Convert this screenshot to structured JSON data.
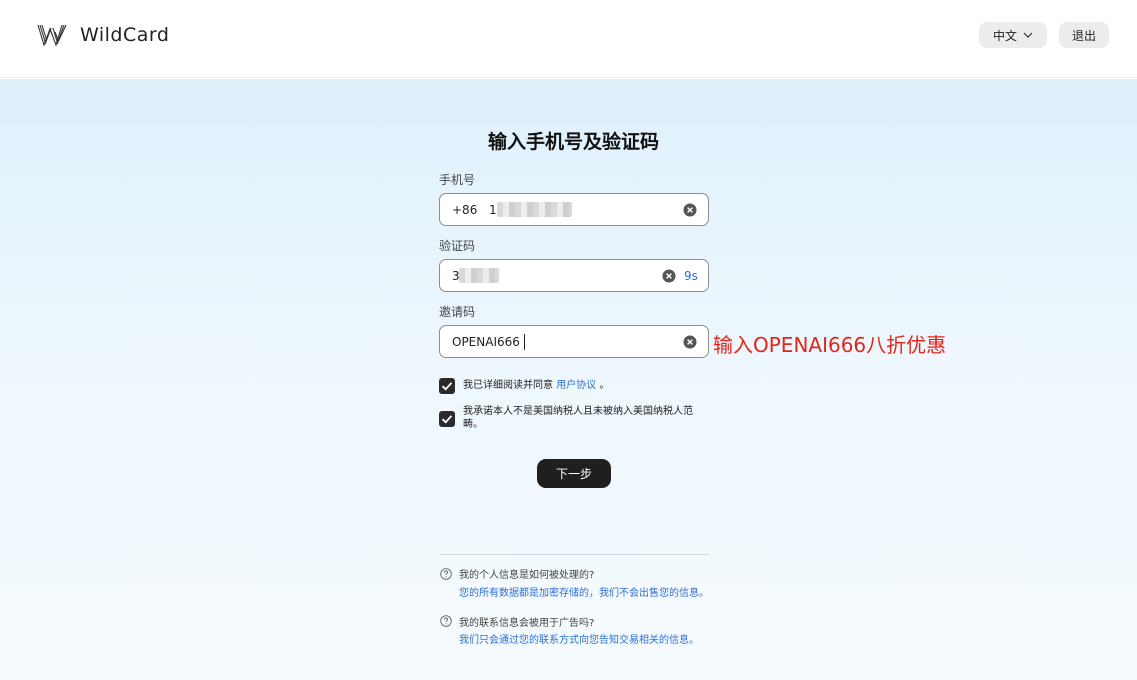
{
  "header": {
    "brand": "WildCard",
    "language_label": "中文",
    "logout_label": "退出"
  },
  "form": {
    "title": "输入手机号及验证码",
    "phone": {
      "label": "手机号",
      "country_code": "+86",
      "value_visible": "1"
    },
    "code": {
      "label": "验证码",
      "value_visible": "3",
      "countdown": "9s"
    },
    "invite": {
      "label": "邀请码",
      "value": "OPENAI666"
    },
    "promo_note": "输入OPENAI666八折优惠",
    "agreements": [
      {
        "text": "我已详细阅读并同意",
        "link": "用户协议",
        "suffix": "。",
        "checked": true
      },
      {
        "text": "我承诺本人不是美国纳税人且未被纳入美国纳税人范畴。",
        "checked": true
      }
    ],
    "next_label": "下一步"
  },
  "faq": [
    {
      "question": "我的个人信息是如何被处理的?",
      "answer": "您的所有数据都是加密存储的，我们不会出售您的信息。"
    },
    {
      "question": "我的联系信息会被用于广告吗?",
      "answer": "我们只会通过您的联系方式向您告知交易相关的信息。"
    }
  ],
  "colors": {
    "accent_link": "#2f6fd6",
    "promo_red": "#e3261b",
    "primary_button": "#1f1f1f"
  }
}
